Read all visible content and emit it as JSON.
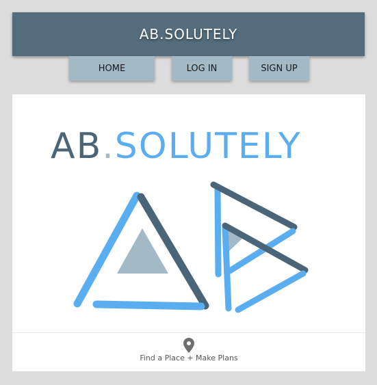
{
  "header": {
    "title": "AB.SOLUTELY"
  },
  "nav": {
    "home_label": "HOME",
    "login_label": "LOG IN",
    "signup_label": "SIGN UP"
  },
  "logo": {
    "word_part1": "AB",
    "word_dot": ".",
    "word_part2": "SOLUTELY"
  },
  "footer": {
    "icon": "map-pin-icon",
    "tagline": "Find a Place + Make Plans"
  },
  "colors": {
    "header_bg": "#546c7c",
    "nav_bg": "#a3b9c6",
    "dark_slate": "#4a6478",
    "bright_blue": "#5aaef0",
    "triangle_fill": "#a3b9c6",
    "page_bg": "#dcdcdc"
  }
}
